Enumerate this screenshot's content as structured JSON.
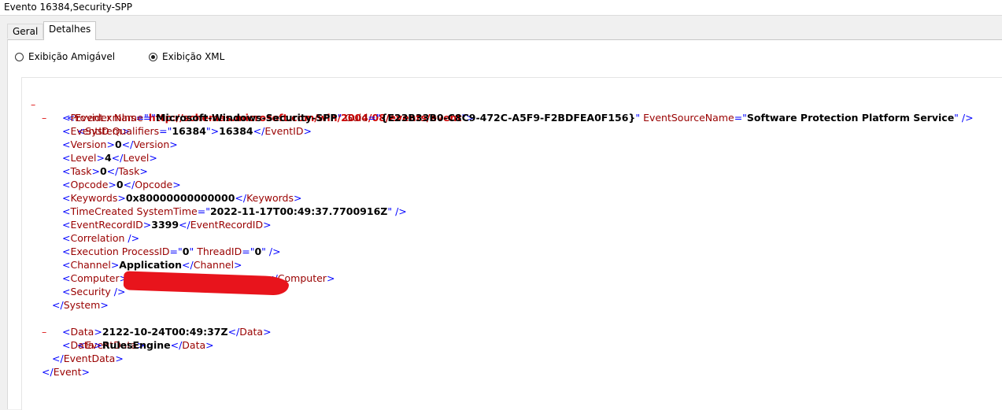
{
  "window": {
    "title": "Evento 16384,Security-SPP"
  },
  "tabs": [
    {
      "label": "Geral"
    },
    {
      "label": "Detalhes"
    }
  ],
  "view": {
    "friendly_label": "Exibição Amigável",
    "xml_label": "Exibição XML",
    "selected": "xml"
  },
  "xml": {
    "collapse_glyph": "–",
    "event_ns_attr": "xmlns",
    "event_ns_value": "http://schemas.microsoft.com/win/2004/08/events/event",
    "provider_name": "Microsoft-Windows-Security-SPP",
    "provider_guid": "{E23B33B0-C8C9-472C-A5F9-F2BDFEA0F156}",
    "provider_event_source": "Software Protection Platform Service",
    "event_id_qualifiers": "16384",
    "event_id": "16384",
    "version": "0",
    "level": "4",
    "task": "0",
    "opcode": "0",
    "keywords": "0x80000000000000",
    "time_created": "2022-11-17T00:49:37.7700916Z",
    "event_record_id": "3399",
    "process_id": "0",
    "thread_id": "0",
    "channel": "Application",
    "data_1": "2122-10-24T00:49:37Z",
    "data_2": "RulesEngine"
  },
  "colors": {
    "redaction": "#e8141c",
    "bracket": "#0000ff",
    "name": "#990000",
    "namespace": "#cc0000"
  }
}
